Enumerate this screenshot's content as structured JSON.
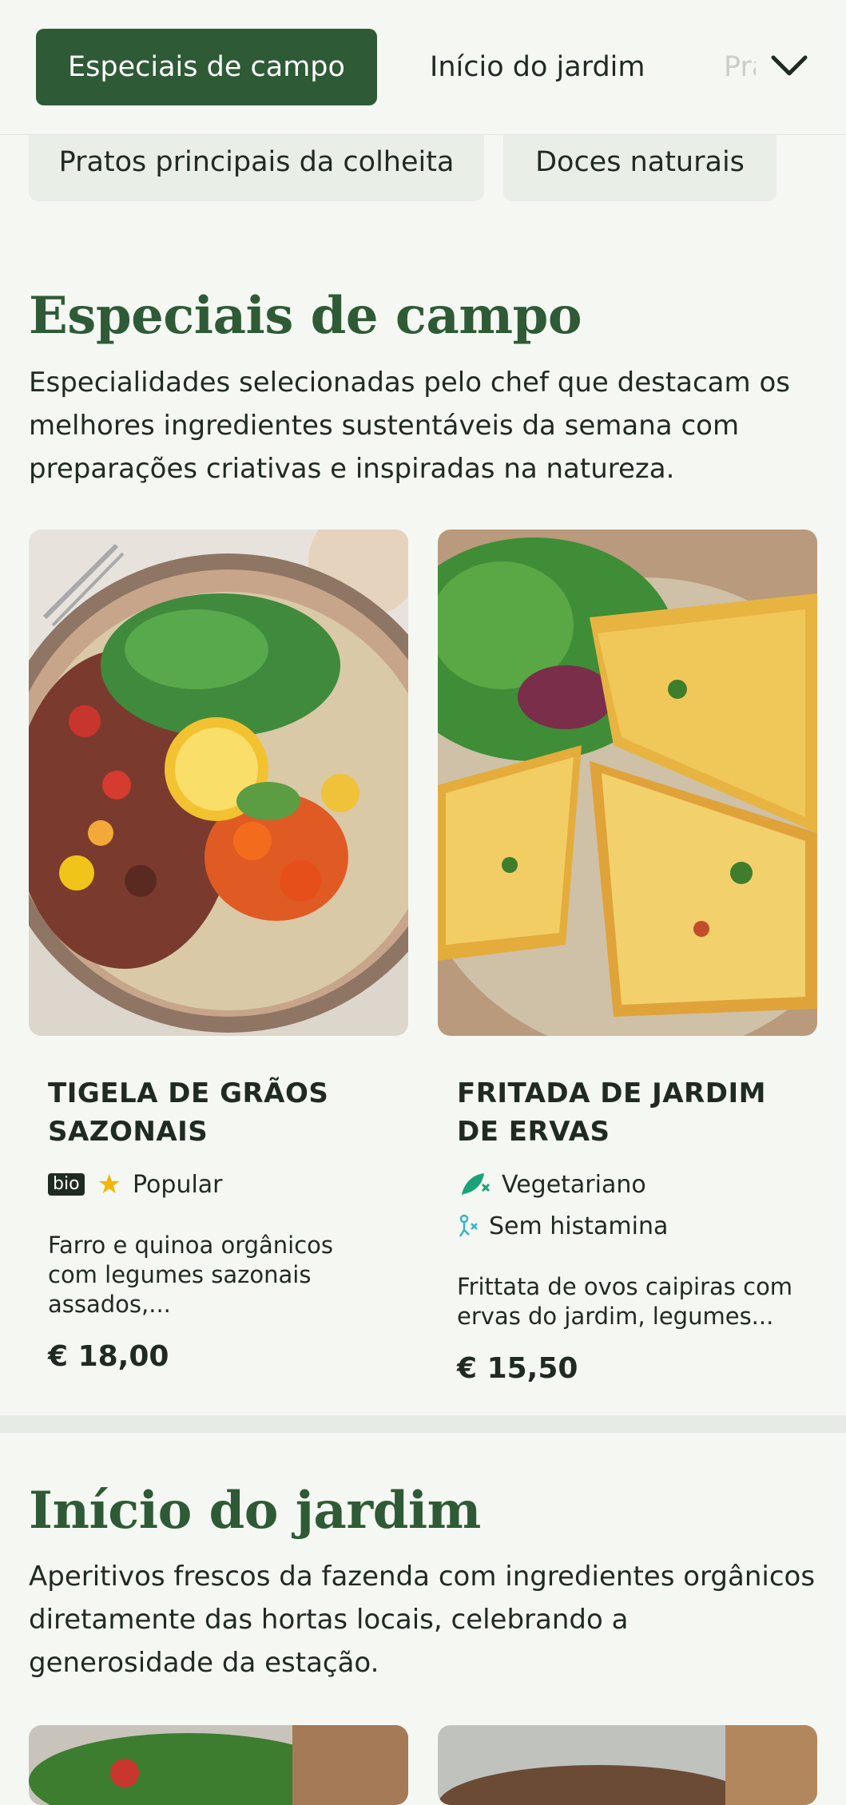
{
  "nav": {
    "tabs": [
      {
        "label": "Especiais de campo",
        "active": true
      },
      {
        "label": "Início do jardim",
        "active": false
      },
      {
        "label": "Pratos principais da colheita",
        "active": false
      }
    ],
    "chevron_icon": "chevron-down-icon",
    "chips": [
      "Pratos principais da colheita",
      "Doces naturais"
    ]
  },
  "sections": [
    {
      "title": "Especiais de campo",
      "description": "Especialidades selecionadas pelo chef que destacam os melhores ingredientes sustentáveis da semana com preparações criativas e inspiradas na natureza.",
      "items": [
        {
          "title": "TIGELA DE GRÃOS SAZONAIS",
          "badge": "bio",
          "tag": "Popular",
          "tag_icon": "star-icon",
          "description": "Farro e quinoa orgânicos com legumes sazonais assados,...",
          "price": "€ 18,00"
        },
        {
          "title": "FRITADA DE JARDIM DE ERVAS",
          "tags": [
            {
              "label": "Vegetariano",
              "icon": "leaf-icon"
            },
            {
              "label": "Sem histamina",
              "icon": "histamine-free-icon"
            }
          ],
          "description": "Frittata de ovos caipiras com ervas do jardim, legumes...",
          "price": "€ 15,50"
        }
      ]
    },
    {
      "title": "Início do jardim",
      "description": "Aperitivos frescos da fazenda com ingredientes orgânicos diretamente das hortas locais, celebrando a generosidade da estação."
    }
  ],
  "colors": {
    "brand_green": "#2e5a36",
    "background": "#f4f7f2",
    "star": "#f2b705",
    "veg_icon": "#1aa37a"
  }
}
